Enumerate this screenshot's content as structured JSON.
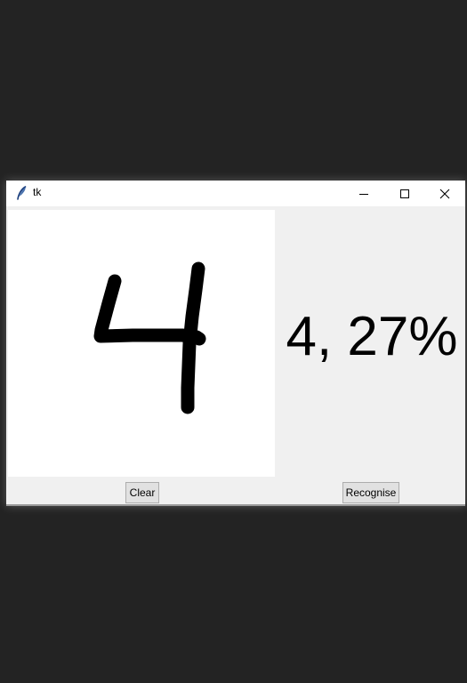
{
  "window": {
    "title": "tk",
    "icon": "feather-icon",
    "controls": [
      "minimize-icon",
      "maximize-icon",
      "close-icon"
    ]
  },
  "canvas": {
    "drawn_digit": "4",
    "stroke_color": "#000000",
    "background": "#ffffff"
  },
  "result": {
    "text": "4, 27%"
  },
  "buttons": {
    "clear_label": "Clear",
    "recognise_label": "Recognise"
  },
  "colors": {
    "desktop": "#232323",
    "window_bg": "#f0f0f0",
    "titlebar": "#ffffff",
    "button_bg": "#e1e1e1",
    "button_border": "#adadad"
  }
}
